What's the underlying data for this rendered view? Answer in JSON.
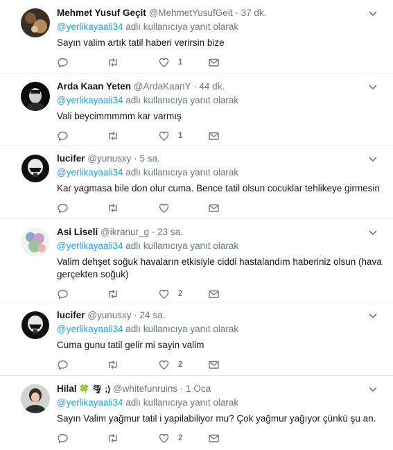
{
  "colors": {
    "link": "#1da1f2",
    "muted": "#657786",
    "text": "#14171a",
    "divider": "#e6ecf0"
  },
  "tweets": [
    {
      "name": "Mehmet Yusuf Geçit",
      "handle": "@MehmetYusufGeit",
      "time": "37 dk.",
      "mention": "@yerlikayaali34",
      "context": "adlı kullanıcıya yanıt olarak",
      "text": "Sayın valim artık tatil haberi verirsin bize",
      "likes": "1"
    },
    {
      "name": "Arda Kaan Yeten",
      "handle": "@ArdaKaanY",
      "time": "44 dk.",
      "mention": "@yerlikayaali34",
      "context": "adlı kullanıcıya yanıt olarak",
      "text": "Vali beycimmmmm kar varmış",
      "likes": "1"
    },
    {
      "name": "lucifer",
      "handle": "@yunusxy",
      "time": "5 sa.",
      "mention": "@yerlikayaali34",
      "context": "adlı kullanıcıya yanıt olarak",
      "text": "Kar yagmasa bile don olur cuma. Bence tatil olsun cocuklar tehlikeye girmesin",
      "likes": ""
    },
    {
      "name": "Asi Liseli",
      "handle": "@ikranur_g",
      "time": "23 sa.",
      "mention": "@yerlikayaali34",
      "context": "adlı kullanıcıya yanıt olarak",
      "text": "Valim dehşet soğuk havaların etkisiyle ciddi hastalandım haberiniz olsun (hava gerçekten soğuk)",
      "likes": "2"
    },
    {
      "name": "lucifer",
      "handle": "@yunusxy",
      "time": "24 sa.",
      "mention": "@yerlikayaali34",
      "context": "adlı kullanıcıya yanıt olarak",
      "text": "Cuma gunu tatil gelir mi sayin valim",
      "likes": "2"
    },
    {
      "name": "Hilal",
      "name_suffix": "🍀 🌪 ;)",
      "handle": "@whitefunruins",
      "time": "1 Oca",
      "mention": "@yerlikayaali34",
      "context": "adlı kullanıcıya yanıt olarak",
      "text": "Sayın Valim yağmur tatil i yapilabiliyor mu? Çok yağmur yağıyor çünkü şu an.",
      "likes": "2"
    }
  ]
}
